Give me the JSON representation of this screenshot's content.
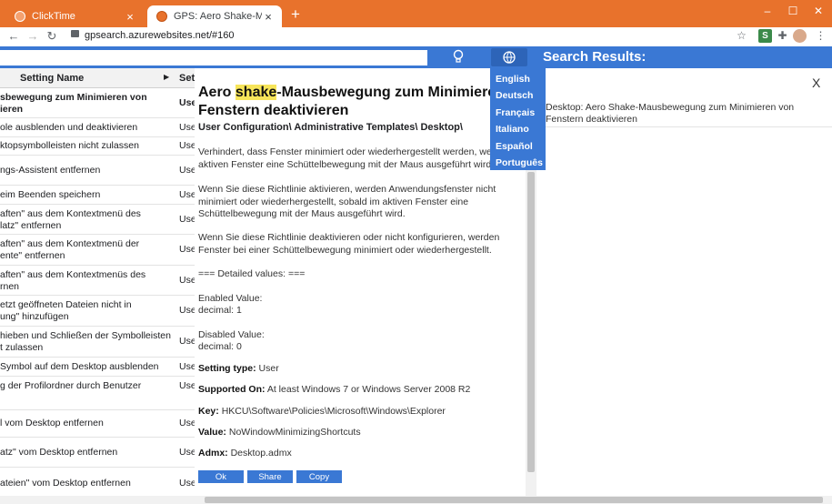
{
  "browser": {
    "tabs": [
      {
        "label": "ClickTime",
        "close": "×"
      },
      {
        "label": "GPS: Aero Shake-Mausbewegung",
        "close": "×"
      }
    ],
    "new_tab": "+",
    "window_controls": [
      "–",
      "☐",
      "✕"
    ],
    "url": "gpsearch.azurewebsites.net/#160",
    "icons": [
      "back-icon",
      "forward-icon",
      "reload-icon",
      "lock-icon",
      "star-icon",
      "extension-icon",
      "puzzle-icon",
      "avatar-icon",
      "menu-icon"
    ]
  },
  "header": {
    "search_value": "",
    "results_title": "Search Results:",
    "accent_color": "#3a78d4"
  },
  "languages": [
    "English",
    "Deutsch",
    "Français",
    "Italiano",
    "Español",
    "Português"
  ],
  "table": {
    "columns": [
      "Setting Name",
      "Sett"
    ],
    "rows": [
      {
        "name": [
          "sbewegung zum Minimieren von",
          "ieren"
        ],
        "scope": "User",
        "selected": true
      },
      {
        "name": [
          "ole ausblenden und deaktivieren"
        ],
        "scope": "Use"
      },
      {
        "name": [
          "ktopsymbolleisten nicht zulassen"
        ],
        "scope": "Use"
      },
      {
        "name": [
          "ngs-Assistent entfernen"
        ],
        "scope": "Use"
      },
      {
        "name": [
          "eim Beenden speichern"
        ],
        "scope": "Use"
      },
      {
        "name": [
          "aften\" aus dem Kontextmenü des",
          "latz\" entfernen"
        ],
        "scope": "Use"
      },
      {
        "name": [
          "aften\" aus dem Kontextmenü der",
          "ente\" entfernen"
        ],
        "scope": "Use"
      },
      {
        "name": [
          "aften\" aus dem Kontextmenüs des",
          "rnen"
        ],
        "scope": "Use"
      },
      {
        "name": [
          "etzt geöffneten Dateien nicht in",
          "ung\" hinzufügen"
        ],
        "scope": "Use"
      },
      {
        "name": [
          "hieben und Schließen der Symbolleisten",
          "t zulassen"
        ],
        "scope": "Use"
      },
      {
        "name": [
          "Symbol auf dem Desktop ausblenden"
        ],
        "scope": "Use"
      },
      {
        "name": [
          "g der Profilordner durch Benutzer"
        ],
        "scope": "Use"
      },
      {
        "name": [
          "l vom Desktop entfernen"
        ],
        "scope": "Use"
      },
      {
        "name": [
          "atz\" vom Desktop entfernen"
        ],
        "scope": "Use"
      },
      {
        "name": [
          "ateien\" vom Desktop entfernen"
        ],
        "scope": "Use"
      }
    ]
  },
  "detail": {
    "title_pre": "Aero ",
    "title_highlight": "shake",
    "title_post": "-Mausbewegung zum Minimieren von Fenstern deaktivieren",
    "path": "User Configuration\\ Administrative Templates\\ Desktop\\",
    "paragraphs": [
      "Verhindert, dass Fenster minimiert oder wiederhergestellt werden, wenn im aktiven Fenster eine Schüttelbewegung mit der Maus ausgeführt wird.",
      "Wenn Sie diese Richtlinie aktivieren, werden Anwendungsfenster nicht minimiert oder wiederhergestellt, sobald im aktiven Fenster eine Schüttelbewegung mit der Maus ausgeführt wird.",
      "Wenn Sie diese Richtlinie deaktivieren oder nicht konfigurieren, werden Fenster bei einer Schüttelbewegung minimiert oder wiederhergestellt."
    ],
    "detailed_header": "=== Detailed values: ===",
    "enabled_label": "Enabled Value:",
    "enabled_value": "decimal: 1",
    "disabled_label": "Disabled Value:",
    "disabled_value": "decimal: 0",
    "setting_type_label": "Setting type:",
    "setting_type": "User",
    "supported_label": "Supported On:",
    "supported": "At least Windows 7 or Windows Server 2008 R2",
    "key_label": "Key:",
    "key": "HKCU\\Software\\Policies\\Microsoft\\Windows\\Explorer",
    "value_label": "Value:",
    "value": "NoWindowMinimizingShortcuts",
    "admx_label": "Admx:",
    "admx": "Desktop.admx",
    "buttons": {
      "ok": "Ok",
      "share": "Share",
      "copy": "Copy"
    }
  },
  "results": {
    "close": "X",
    "item": "Desktop: Aero Shake-Mausbewegung zum Minimieren von Fenstern deaktivieren"
  }
}
